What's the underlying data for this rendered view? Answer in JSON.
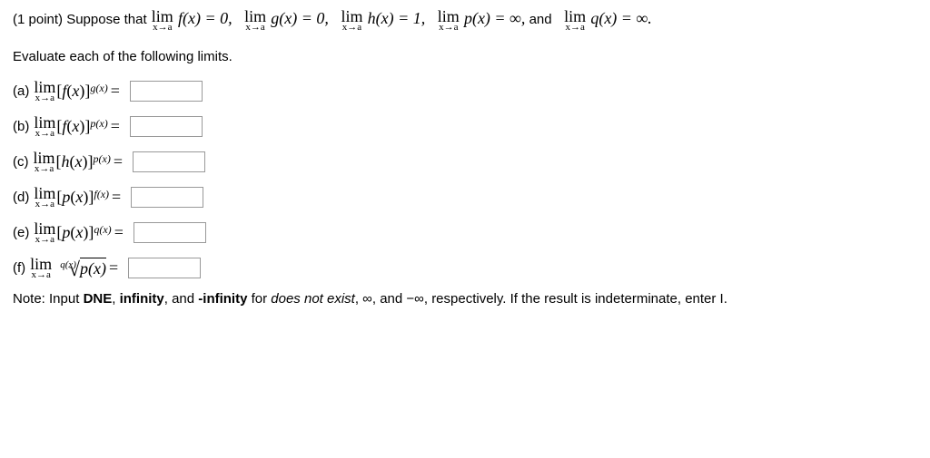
{
  "points": "(1 point)",
  "suppose": "Suppose that",
  "lim_label": "lim",
  "lim_sub": "x→a",
  "cond1": "f(x) = 0,",
  "cond2": "g(x) = 0,",
  "cond3": "h(x) = 1,",
  "cond4": "p(x) = ∞,",
  "and": "and",
  "cond5": "q(x) = ∞.",
  "instruction": "Evaluate each of the following limits.",
  "parts": {
    "a": {
      "label": "(a)"
    },
    "b": {
      "label": "(b)"
    },
    "c": {
      "label": "(c)"
    },
    "d": {
      "label": "(d)"
    },
    "e": {
      "label": "(e)"
    },
    "f": {
      "label": "(f)"
    }
  },
  "expr": {
    "fx_g": "[f(x)]",
    "gx_sup": "g(x)",
    "fx_p": "[f(x)]",
    "px_sup": "p(x)",
    "hx_p": "[h(x)]",
    "qx_p": "[p(x)]",
    "fx_sup": "f(x)",
    "qx_q": "[p(x)]",
    "qx_sup": "q(x)",
    "root_idx": "q(x)",
    "radicand": "p(x)"
  },
  "equals": "=",
  "note_pre": "Note: Input ",
  "note_dne": "DNE",
  "note_c1": ", ",
  "note_inf": "infinity",
  "note_c2": ", and ",
  "note_ninf": "-infinity",
  "note_for": " for ",
  "note_dnei": "does not exist",
  "note_tail": ", ∞, and −∞, respectively. If the result is indeterminate, enter I."
}
